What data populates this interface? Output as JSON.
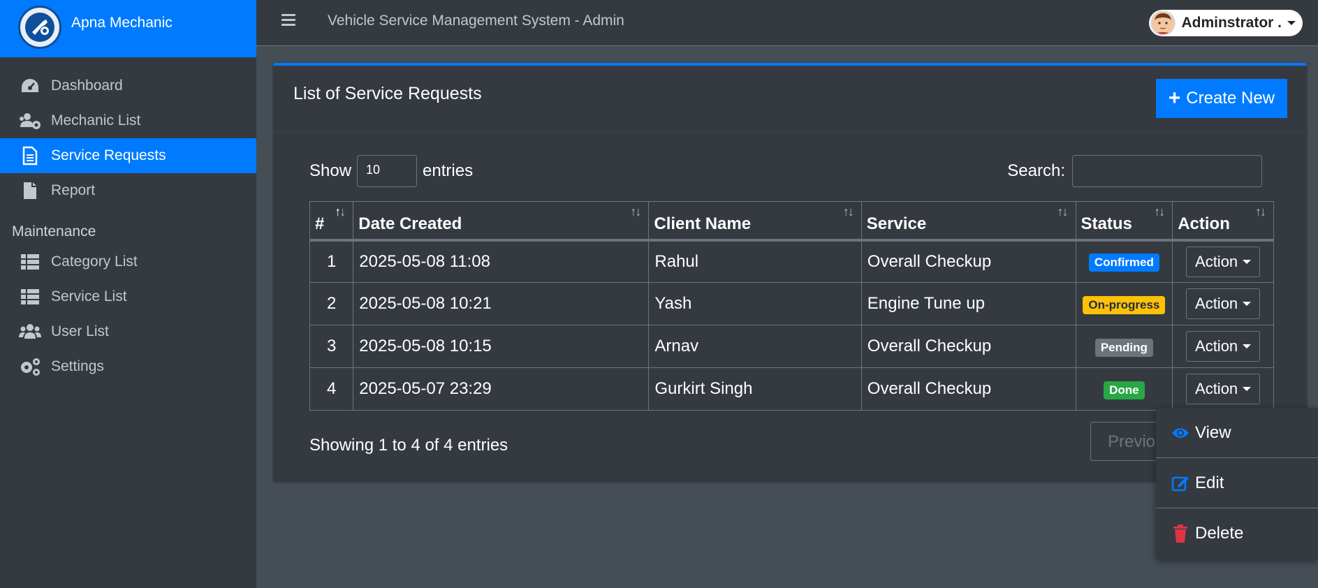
{
  "brand": {
    "name": "Apna Mechanic"
  },
  "sidebar": {
    "items": [
      {
        "label": "Dashboard",
        "icon": "dashboard-gauge-icon"
      },
      {
        "label": "Mechanic List",
        "icon": "users-cog-icon"
      },
      {
        "label": "Service Requests",
        "icon": "file-document-icon",
        "active": true
      },
      {
        "label": "Report",
        "icon": "file-icon"
      }
    ],
    "maintenance_header": "Maintenance",
    "maintenance_items": [
      {
        "label": "Category List",
        "icon": "table-list-icon"
      },
      {
        "label": "Service List",
        "icon": "table-list-icon"
      },
      {
        "label": "User List",
        "icon": "users-icon"
      },
      {
        "label": "Settings",
        "icon": "cogs-icon"
      }
    ]
  },
  "topbar": {
    "title": "Vehicle Service Management System - Admin",
    "user": "Adminstrator ."
  },
  "card": {
    "title": "List of Service Requests",
    "create_label": "Create New"
  },
  "table_controls": {
    "show_label": "Show",
    "entries_value": "10",
    "entries_label": "entries",
    "search_label": "Search:"
  },
  "table": {
    "headers": [
      "#",
      "Date Created",
      "Client Name",
      "Service",
      "Status",
      "Action"
    ],
    "rows": [
      {
        "num": "1",
        "date": "2025-05-08 11:08",
        "client": "Rahul",
        "service": "Overall Checkup",
        "status": "Confirmed",
        "status_color": "#007bff",
        "status_text_color": "#ffffff",
        "action": "Action"
      },
      {
        "num": "2",
        "date": "2025-05-08 10:21",
        "client": "Yash",
        "service": "Engine Tune up",
        "status": "On-progress",
        "status_color": "#ffc107",
        "status_text_color": "#1f2d3d",
        "action": "Action"
      },
      {
        "num": "3",
        "date": "2025-05-08 10:15",
        "client": "Arnav",
        "service": "Overall Checkup",
        "status": "Pending",
        "status_color": "#6c757d",
        "status_text_color": "#ffffff",
        "action": "Action"
      },
      {
        "num": "4",
        "date": "2025-05-07 23:29",
        "client": "Gurkirt Singh",
        "service": "Overall Checkup",
        "status": "Done",
        "status_color": "#28a745",
        "status_text_color": "#ffffff",
        "action": "Action"
      }
    ]
  },
  "footer": {
    "info": "Showing 1 to 4 of 4 entries",
    "previous": "Previous"
  },
  "dropdown": {
    "view": "View",
    "edit": "Edit",
    "delete": "Delete"
  },
  "colors": {
    "primary": "#007bff",
    "danger": "#dc3545",
    "sidebar_bg": "#343a40",
    "content_bg": "#454d55"
  }
}
